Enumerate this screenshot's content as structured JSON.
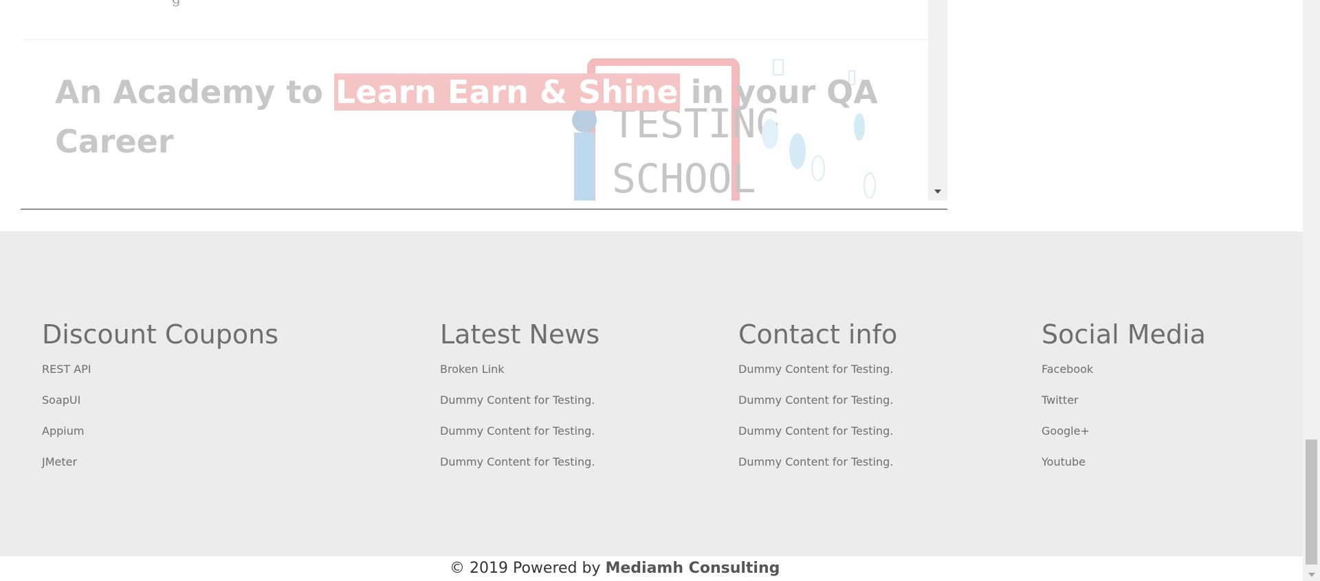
{
  "iframe": {
    "hero": {
      "prefix": "An Academy to ",
      "highlight": "Learn Earn & Shine",
      "suffix": "  in your QA Career"
    },
    "illustration_text": [
      "TESTING",
      "SCHOOL"
    ]
  },
  "footer": {
    "columns": [
      {
        "heading": "Discount Coupons",
        "links": [
          "REST API",
          "SoapUI",
          "Appium",
          "JMeter"
        ]
      },
      {
        "heading": "Latest News",
        "links": [
          "Broken Link",
          "Dummy Content for Testing.",
          "Dummy Content for Testing.",
          "Dummy Content for Testing."
        ]
      },
      {
        "heading": "Contact info",
        "links": [
          "Dummy Content for Testing.",
          "Dummy Content for Testing.",
          "Dummy Content for Testing.",
          "Dummy Content for Testing."
        ]
      },
      {
        "heading": "Social Media",
        "links": [
          "Facebook",
          "Twitter",
          "Google+",
          "Youtube"
        ]
      }
    ]
  },
  "copyright": {
    "text": "© 2019 Powered by ",
    "link": "Mediamh Consulting"
  },
  "colors": {
    "highlight_bg": "#f5c4c4",
    "footer_bg": "#ececec",
    "text_muted": "#6e6e6e"
  }
}
